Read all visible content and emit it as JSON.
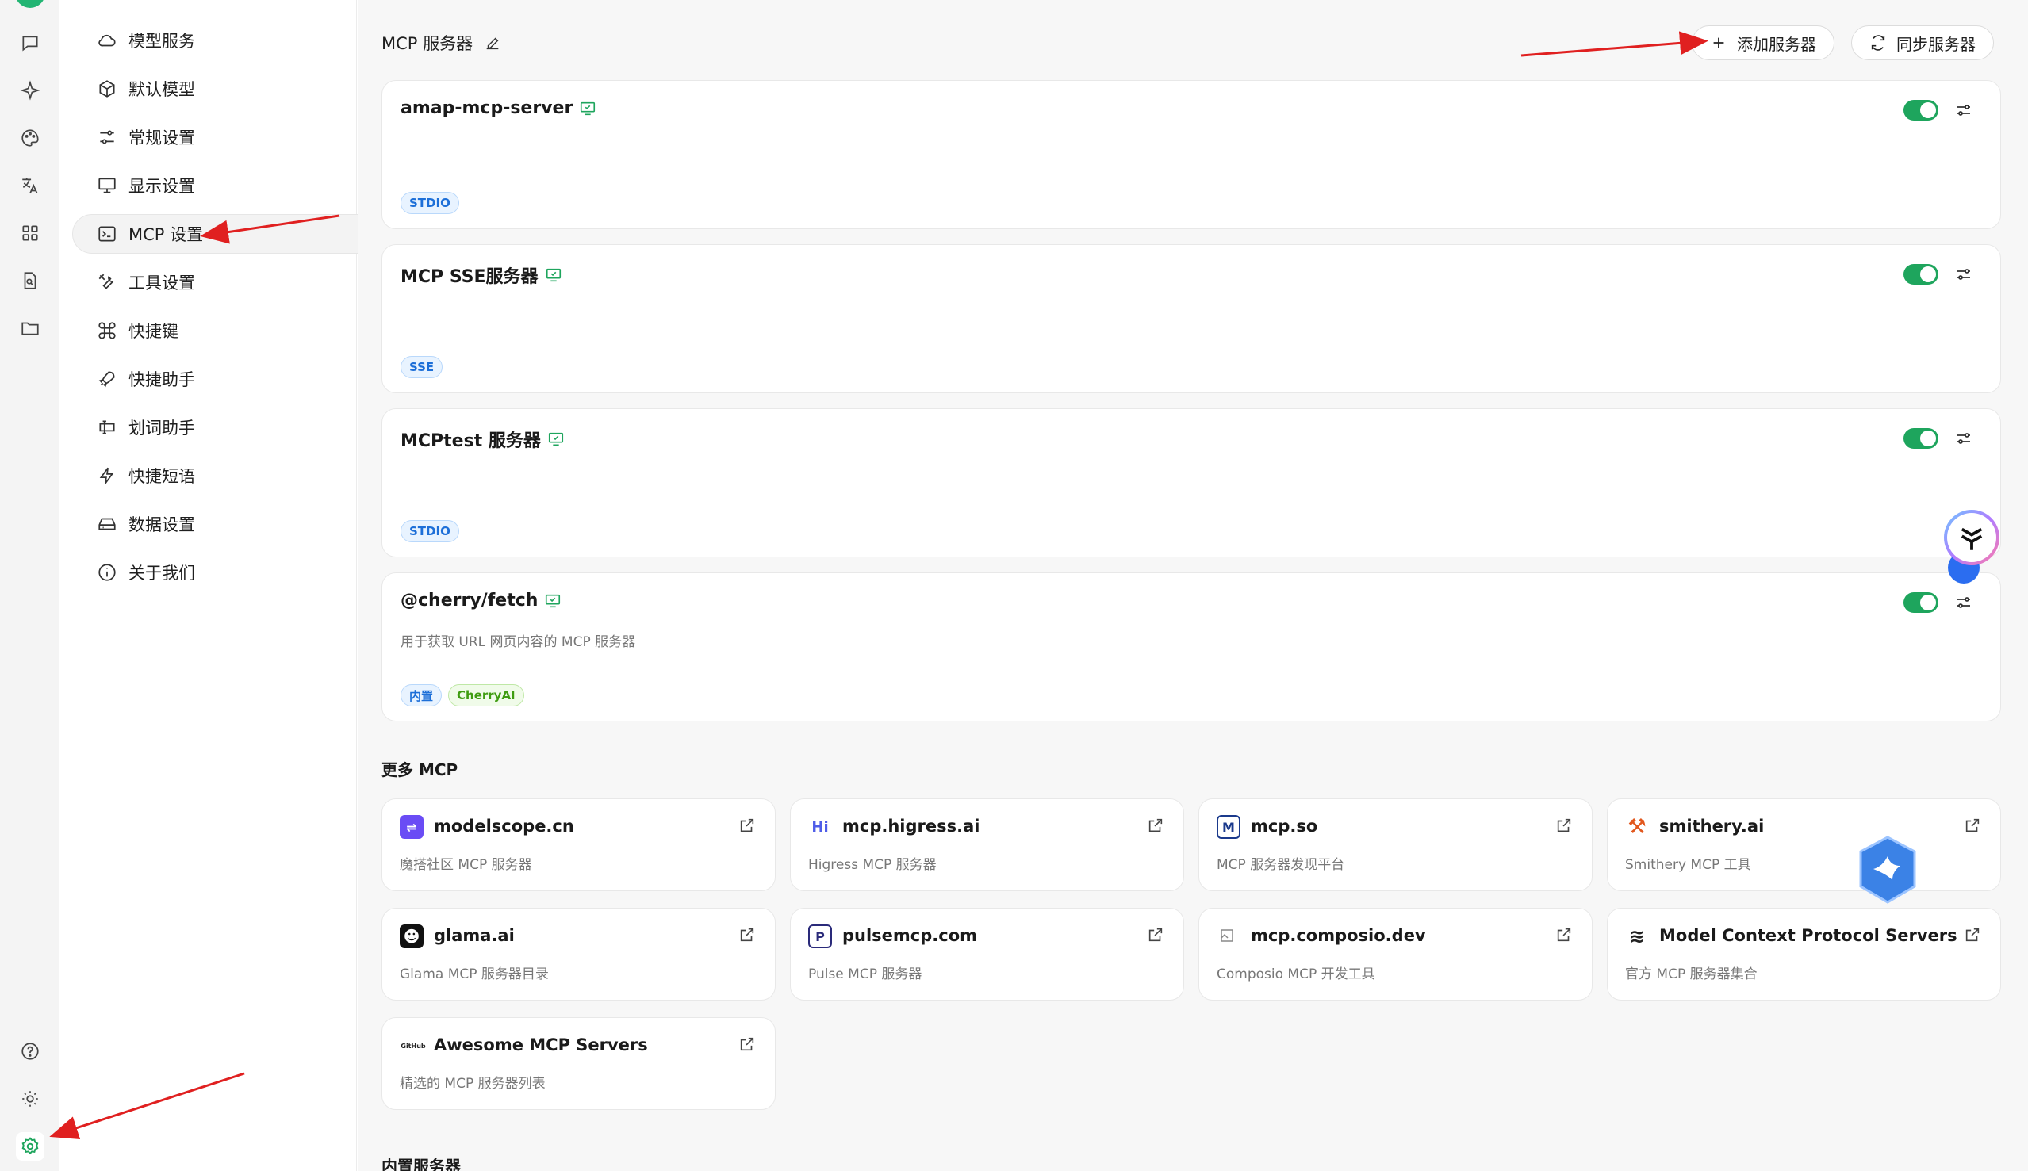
{
  "accent_color": "#1ea55d",
  "rail": {
    "icons": [
      "chat-icon",
      "sparkle-icon",
      "palette-icon",
      "translate-icon",
      "apps-icon",
      "doc-search-icon",
      "folder-icon",
      "help-icon",
      "theme-icon",
      "settings-icon"
    ]
  },
  "menu": {
    "items": [
      {
        "label": "模型服务",
        "icon": "cloud-icon"
      },
      {
        "label": "默认模型",
        "icon": "cube-icon"
      },
      {
        "label": "常规设置",
        "icon": "sliders-icon"
      },
      {
        "label": "显示设置",
        "icon": "monitor-icon"
      },
      {
        "label": "MCP 设置",
        "icon": "terminal-icon"
      },
      {
        "label": "工具设置",
        "icon": "tools-icon"
      },
      {
        "label": "快捷键",
        "icon": "command-icon"
      },
      {
        "label": "快捷助手",
        "icon": "rocket-icon"
      },
      {
        "label": "划词助手",
        "icon": "text-select-icon"
      },
      {
        "label": "快捷短语",
        "icon": "zap-icon"
      },
      {
        "label": "数据设置",
        "icon": "drive-icon"
      },
      {
        "label": "关于我们",
        "icon": "info-icon"
      }
    ]
  },
  "header": {
    "title": "MCP 服务器",
    "add_button": "添加服务器",
    "sync_button": "同步服务器"
  },
  "servers": [
    {
      "name": "amap-mcp-server",
      "desc": "",
      "tags": [
        "STDIO"
      ],
      "enabled": true
    },
    {
      "name": "MCP SSE服务器",
      "desc": "",
      "tags": [
        "SSE"
      ],
      "enabled": true
    },
    {
      "name": "MCPtest 服务器",
      "desc": "",
      "tags": [
        "STDIO"
      ],
      "enabled": true
    },
    {
      "name": "@cherry/fetch",
      "desc": "用于获取 URL 网页内容的 MCP 服务器",
      "tags": [
        "内置",
        "CherryAI"
      ],
      "enabled": true
    }
  ],
  "more_mcp": {
    "title": "更多 MCP",
    "links": [
      {
        "title": "modelscope.cn",
        "desc": "魔搭社区 MCP 服务器",
        "logo": "⇌",
        "logo_color": "#6a4cf5"
      },
      {
        "title": "mcp.higress.ai",
        "desc": "Higress MCP 服务器",
        "logo": "Hi",
        "logo_color": "#ffffff"
      },
      {
        "title": "mcp.so",
        "desc": "MCP 服务器发现平台",
        "logo": "M",
        "logo_color": "#ffffff"
      },
      {
        "title": "smithery.ai",
        "desc": "Smithery MCP 工具",
        "logo": "⚒",
        "logo_color": "#e2581e"
      },
      {
        "title": "glama.ai",
        "desc": "Glama MCP 服务器目录",
        "logo": "☻",
        "logo_color": "#111111"
      },
      {
        "title": "pulsemcp.com",
        "desc": "Pulse MCP 服务器",
        "logo": "P",
        "logo_color": "#ffffff"
      },
      {
        "title": "mcp.composio.dev",
        "desc": "Composio MCP 开发工具",
        "logo": "",
        "logo_color": "#ffffff"
      },
      {
        "title": "Model Context Protocol Servers",
        "desc": "官方 MCP 服务器集合",
        "logo": "≋",
        "logo_color": "#ffffff"
      },
      {
        "title": "Awesome MCP Servers",
        "desc": "精选的 MCP 服务器列表",
        "logo": "GitHub",
        "logo_color": "#ffffff"
      }
    ]
  },
  "builtin": {
    "title": "内置服务器"
  }
}
